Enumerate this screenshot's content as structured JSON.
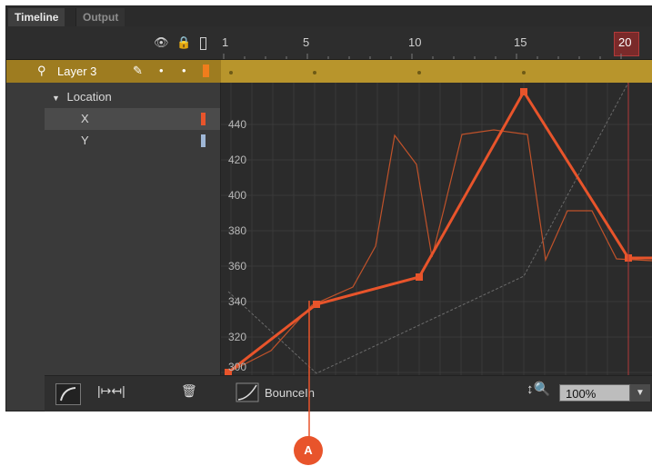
{
  "tabs": [
    {
      "label": "Timeline"
    },
    {
      "label": "Output"
    }
  ],
  "header_icons": [
    "eye-icon",
    "lock-icon",
    "outline-icon"
  ],
  "frames": [
    "1",
    "5",
    "10",
    "15",
    "20"
  ],
  "layer": {
    "name": "Layer 3",
    "icons": [
      "pencil-icon",
      "dot-icon",
      "dot-icon"
    ],
    "color": "#f07d1c"
  },
  "tree": {
    "group": "Location",
    "properties": [
      {
        "label": "X",
        "color": "#e8542b"
      },
      {
        "label": "Y",
        "color": "#9fb7d6"
      }
    ]
  },
  "graph": {
    "y_labels": [
      "440",
      "420",
      "400",
      "380",
      "360",
      "340",
      "320",
      "300"
    ]
  },
  "bottom": {
    "ease_preset": "BounceIn",
    "zoom_value": "100%"
  },
  "callout": {
    "label": "A"
  },
  "colors": {
    "accent": "#e8542b",
    "layer_bar": "#b8952c",
    "playhead": "#b13a3a"
  }
}
